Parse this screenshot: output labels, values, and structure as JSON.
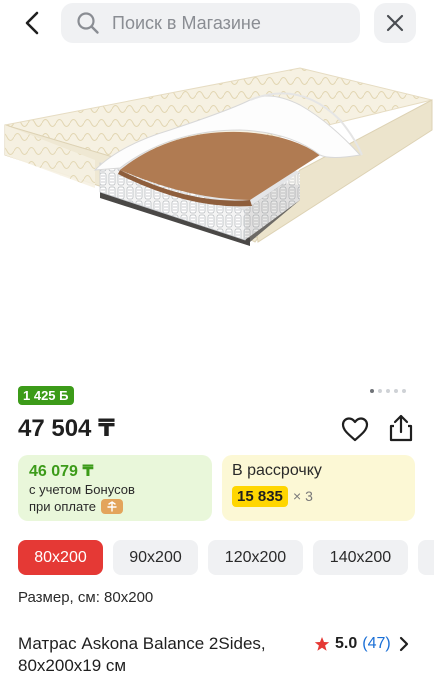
{
  "search": {
    "placeholder": "Поиск в Магазине"
  },
  "product": {
    "bonus_badge": "1 425 Б",
    "price": "47 504 ₸",
    "title": "Матрас Askona Balance 2Sides, 80x200x19 см",
    "rating": "5.0",
    "reviews": "(47)"
  },
  "gallery": {
    "total_images": 5,
    "active_index": 0
  },
  "bonus_offer": {
    "price": "46 079 ₸",
    "note_line1": "с учетом Бонусов",
    "note_line2": "при оплате"
  },
  "installment": {
    "title": "В рассрочку",
    "amount": "15 835",
    "multiplier": "× 3"
  },
  "sizes": {
    "options": [
      "80x200",
      "90x200",
      "120x200",
      "140x200"
    ],
    "selected": "80x200",
    "caption": "Размер, см: 80x200"
  },
  "colors": {
    "accent_red": "#e53935",
    "bonus_green": "#3c9b19",
    "installment_yellow": "#ffd600",
    "link_blue": "#1a6fd6"
  },
  "icons": [
    "back-arrow",
    "search",
    "close",
    "heart",
    "share",
    "star",
    "chevron-right",
    "wallet"
  ]
}
